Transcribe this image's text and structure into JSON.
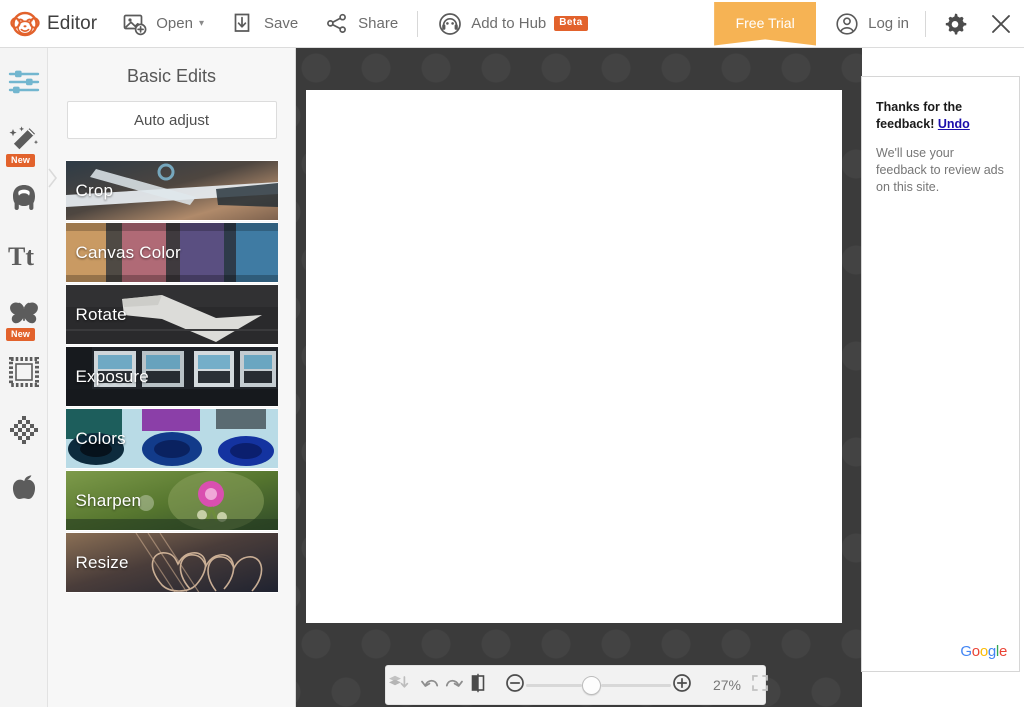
{
  "app": {
    "brand_name": "Editor",
    "brand_logo_icon": "picmonkey-monkey-logo"
  },
  "topbar": {
    "items": [
      {
        "label": "Open",
        "icon": "open-image-icon",
        "has_caret": true,
        "caret": "▾"
      },
      {
        "label": "Save",
        "icon": "save-download-icon",
        "has_caret": false
      },
      {
        "label": "Share",
        "icon": "share-nodes-icon",
        "has_caret": false
      }
    ],
    "hub": {
      "label": "Add to Hub",
      "icon": "hub-headphones-icon",
      "badge": "Beta"
    },
    "free_trial": "Free Trial",
    "login": {
      "label": "Log in",
      "icon": "user-account-icon"
    },
    "settings_icon": "gear-icon",
    "close_icon": "close-x-icon",
    "colors": {
      "free_trial_bg": "#f6b354",
      "beta_badge_bg": "#e2622c",
      "brand_orange": "#e2622c"
    }
  },
  "rail": {
    "items": [
      {
        "name": "basic-edits",
        "icon": "sliders-icon",
        "active": true,
        "badge": null
      },
      {
        "name": "effects",
        "icon": "magic-wand-icon",
        "active": false,
        "badge": "New"
      },
      {
        "name": "touch-up",
        "icon": "face-touchup-icon",
        "active": false,
        "badge": null
      },
      {
        "name": "text",
        "icon": "text-tt-icon",
        "active": false,
        "badge": null
      },
      {
        "name": "overlays",
        "icon": "butterfly-icon",
        "active": false,
        "badge": "New"
      },
      {
        "name": "frames",
        "icon": "frame-stamp-icon",
        "active": false,
        "badge": null
      },
      {
        "name": "textures",
        "icon": "texture-lattice-icon",
        "active": false,
        "badge": null
      },
      {
        "name": "themes",
        "icon": "apple-icon",
        "active": false,
        "badge": null
      }
    ]
  },
  "panel": {
    "title": "Basic Edits",
    "auto_adjust_label": "Auto adjust",
    "collapse_icon": "chevron-right-icon",
    "thumbs": [
      {
        "label": "Crop"
      },
      {
        "label": "Canvas Color"
      },
      {
        "label": "Rotate"
      },
      {
        "label": "Exposure"
      },
      {
        "label": "Colors"
      },
      {
        "label": "Sharpen"
      },
      {
        "label": "Resize"
      }
    ]
  },
  "stage": {
    "canvas_bg_color": "#3b3b3b",
    "artboard_color": "#ffffff"
  },
  "bottombar": {
    "flatten_icon": "layers-flatten-icon",
    "undo_icon": "undo-arrow-icon",
    "redo_icon": "redo-arrow-icon",
    "compare_icon": "compare-split-icon",
    "zoom_out_icon": "zoom-out-minus-icon",
    "zoom_in_icon": "zoom-in-plus-icon",
    "zoom_value": "27%",
    "fullscreen_icon": "fit-to-screen-icon"
  },
  "ad": {
    "headline": "Thanks for the feedback!",
    "undo_label": "Undo",
    "body": "We'll use your feedback to review ads on this site.",
    "logo_letters": [
      "G",
      "o",
      "o",
      "g",
      "l",
      "e"
    ]
  }
}
